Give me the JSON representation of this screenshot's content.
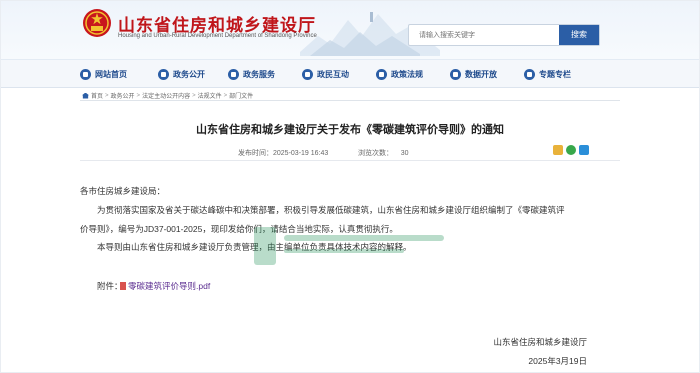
{
  "header": {
    "site_title": "山东省住房和城乡建设厅",
    "site_subtitle": "Housing and Urban-Rural Development Department of Shandong Province",
    "search_placeholder": "请输入搜索关键字",
    "search_button": "搜索"
  },
  "nav": {
    "items": [
      {
        "label": "网站首页",
        "icon": "home-icon"
      },
      {
        "label": "政务公开",
        "icon": "document-icon"
      },
      {
        "label": "政务服务",
        "icon": "service-icon"
      },
      {
        "label": "政民互动",
        "icon": "chat-icon"
      },
      {
        "label": "政策法规",
        "icon": "law-icon"
      },
      {
        "label": "数据开放",
        "icon": "data-icon"
      },
      {
        "label": "专题专栏",
        "icon": "topic-icon"
      }
    ]
  },
  "breadcrumb": [
    "首页",
    "政务公开",
    "法定主动公开内容",
    "法规文件",
    "部门文件"
  ],
  "article": {
    "title": "山东省住房和城乡建设厅关于发布《零碳建筑评价导则》的通知",
    "publish_label": "发布时间：",
    "publish_time": "2025-03-19 16:43",
    "views_label": "浏览次数：",
    "views": "30",
    "salutation": "各市住房城乡建设局：",
    "para1_line1": "为贯彻落实国家及省关于碳达峰碳中和决策部署，积极引导发展低碳建筑，山东省住房和城乡建设厅组织编制了《零碳建筑评",
    "para1_line2": "价导则》，编号为JD37-001-2025，现印发给你们，请结合当地实际，认真贯彻执行。",
    "para2": "本导则由山东省住房和城乡建设厅负责管理，由主编单位负责具体技术内容的解释。",
    "attachment_label": "附件：",
    "attachment_name": "零碳建筑评价导则.pdf",
    "signature": "山东省住房和城乡建设厅",
    "date": "2025年3月19日"
  },
  "colors": {
    "brand_red": "#c0161b",
    "nav_blue": "#1e4a8c",
    "link_purple": "#5b2d90"
  }
}
